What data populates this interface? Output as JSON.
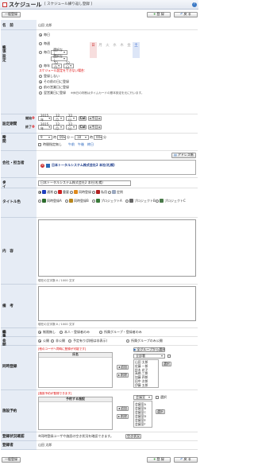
{
  "header": {
    "title": "スケジュール",
    "subtitle": "[ スケジュール繰り返し登録 ]",
    "help": "?"
  },
  "toolbar": {
    "general_reg": "一般登録",
    "register": "登 録",
    "back": "戻 る"
  },
  "labels": {
    "name": "名　前",
    "repeat": "拡張設定",
    "period": "設定期間",
    "time": "時間",
    "company": "会社・担当者",
    "title": "タイトル",
    "title_color": "タイトル色",
    "content": "内　容",
    "memo": "備　考",
    "edit_perm": "編集権限",
    "public": "公　開",
    "attendees": "同時登録",
    "facility": "施設予約",
    "ack": "登録状況確認",
    "registrant": "登録者"
  },
  "name": {
    "value": "山田 太郎"
  },
  "repeat": {
    "daily": "毎日",
    "weekly": "毎週",
    "monthly": "毎月",
    "monthly_sel": "選択なし",
    "monthly_sel2": "選択なし",
    "days": [
      "日",
      "月",
      "火",
      "水",
      "木",
      "金",
      "土"
    ],
    "yearly": "毎年",
    "yearly_m": "12月",
    "yearly_d": "22日",
    "note": "スケジュール設定をできない場合：",
    "opt1": "登録しない",
    "opt2": "その前の日に登録",
    "opt3": "前の営業日に登録",
    "opt4": "翌営業日に登録",
    "note2": "※休日の判断はタイムカードの基本設定を元に行います。"
  },
  "period": {
    "start_label": "開始",
    "end_label": "終了",
    "year": "2015年",
    "month": "12月",
    "day": "22日",
    "cal": "Cal",
    "today": "今日"
  },
  "time": {
    "h1": "9",
    "m1": "00",
    "h2": "18",
    "m2": "00",
    "hour": "時",
    "min": "分",
    "to": "〜",
    "unspecified": "時間指定無し",
    "am": "午前",
    "pm": "午後",
    "allday": "終日"
  },
  "company": {
    "btn": "アドレス帳",
    "value": "日本トータルシステム株式会社2 本社(札幌)"
  },
  "title": {
    "value": "日本トータルシステム株式会社2 本社(札幌)"
  },
  "colors": [
    {
      "label": "通常",
      "color": "#1f3fbf"
    },
    {
      "label": "重要",
      "color": "#cc2222"
    },
    {
      "label": "同時登録",
      "color": "#e08a1c"
    },
    {
      "label": "私用",
      "color": "#b22222"
    },
    {
      "label": "定例",
      "color": "#9aa8c0"
    },
    {
      "label": "同時登録A",
      "color": "#2b6b2b"
    },
    {
      "label": "同時登録B",
      "color": "#b8861c"
    },
    {
      "label": "プロジェクトA",
      "color": "#3a7a3a"
    },
    {
      "label": "プロジェクトB",
      "color": "#666666"
    },
    {
      "label": "プロジェクトC",
      "color": "#4a7a4a"
    }
  ],
  "counter": {
    "content": "現在の文字数:0 / 1000 文字",
    "memo": "現在の文字数:0 / 1000 文字"
  },
  "edit_perm": {
    "o1": "制限無し",
    "o2": "本人・登録者のみ",
    "o3": "所属グループ・登録者のみ"
  },
  "public": {
    "o1": "公開",
    "o2": "非公開",
    "o3": "予定有り(詳細は非表示)",
    "o4": "所属グループのみ公開"
  },
  "attendees": {
    "hint": "[他のユーザへ同時に登録が可能です]",
    "group_btn": "全グループから選択",
    "dept": "全部署",
    "col": "氏名",
    "members": [
      "山田 太郎",
      "佐藤 一郎",
      "鈴木 花子",
      "高橋 三郎",
      "加藤 四郎",
      "田中 次郎",
      "伊藤 五郎"
    ],
    "add": "追加",
    "remove": "削除",
    "select": "選択"
  },
  "facility": {
    "hint": "[施設予約が登録できます]",
    "col": "予約する施設",
    "group": "会議室",
    "items": [
      "会議室A",
      "会議室B",
      "会議室C",
      "会議室D",
      "会議室E",
      "会議室F"
    ],
    "add": "追加",
    "remove": "削除",
    "select": "選択"
  },
  "ack": {
    "text": "※同時登録ユーザや施設の空き状況を確認できます。",
    "btn": "空き状況"
  },
  "registrant": {
    "value": "山田 太郎"
  }
}
